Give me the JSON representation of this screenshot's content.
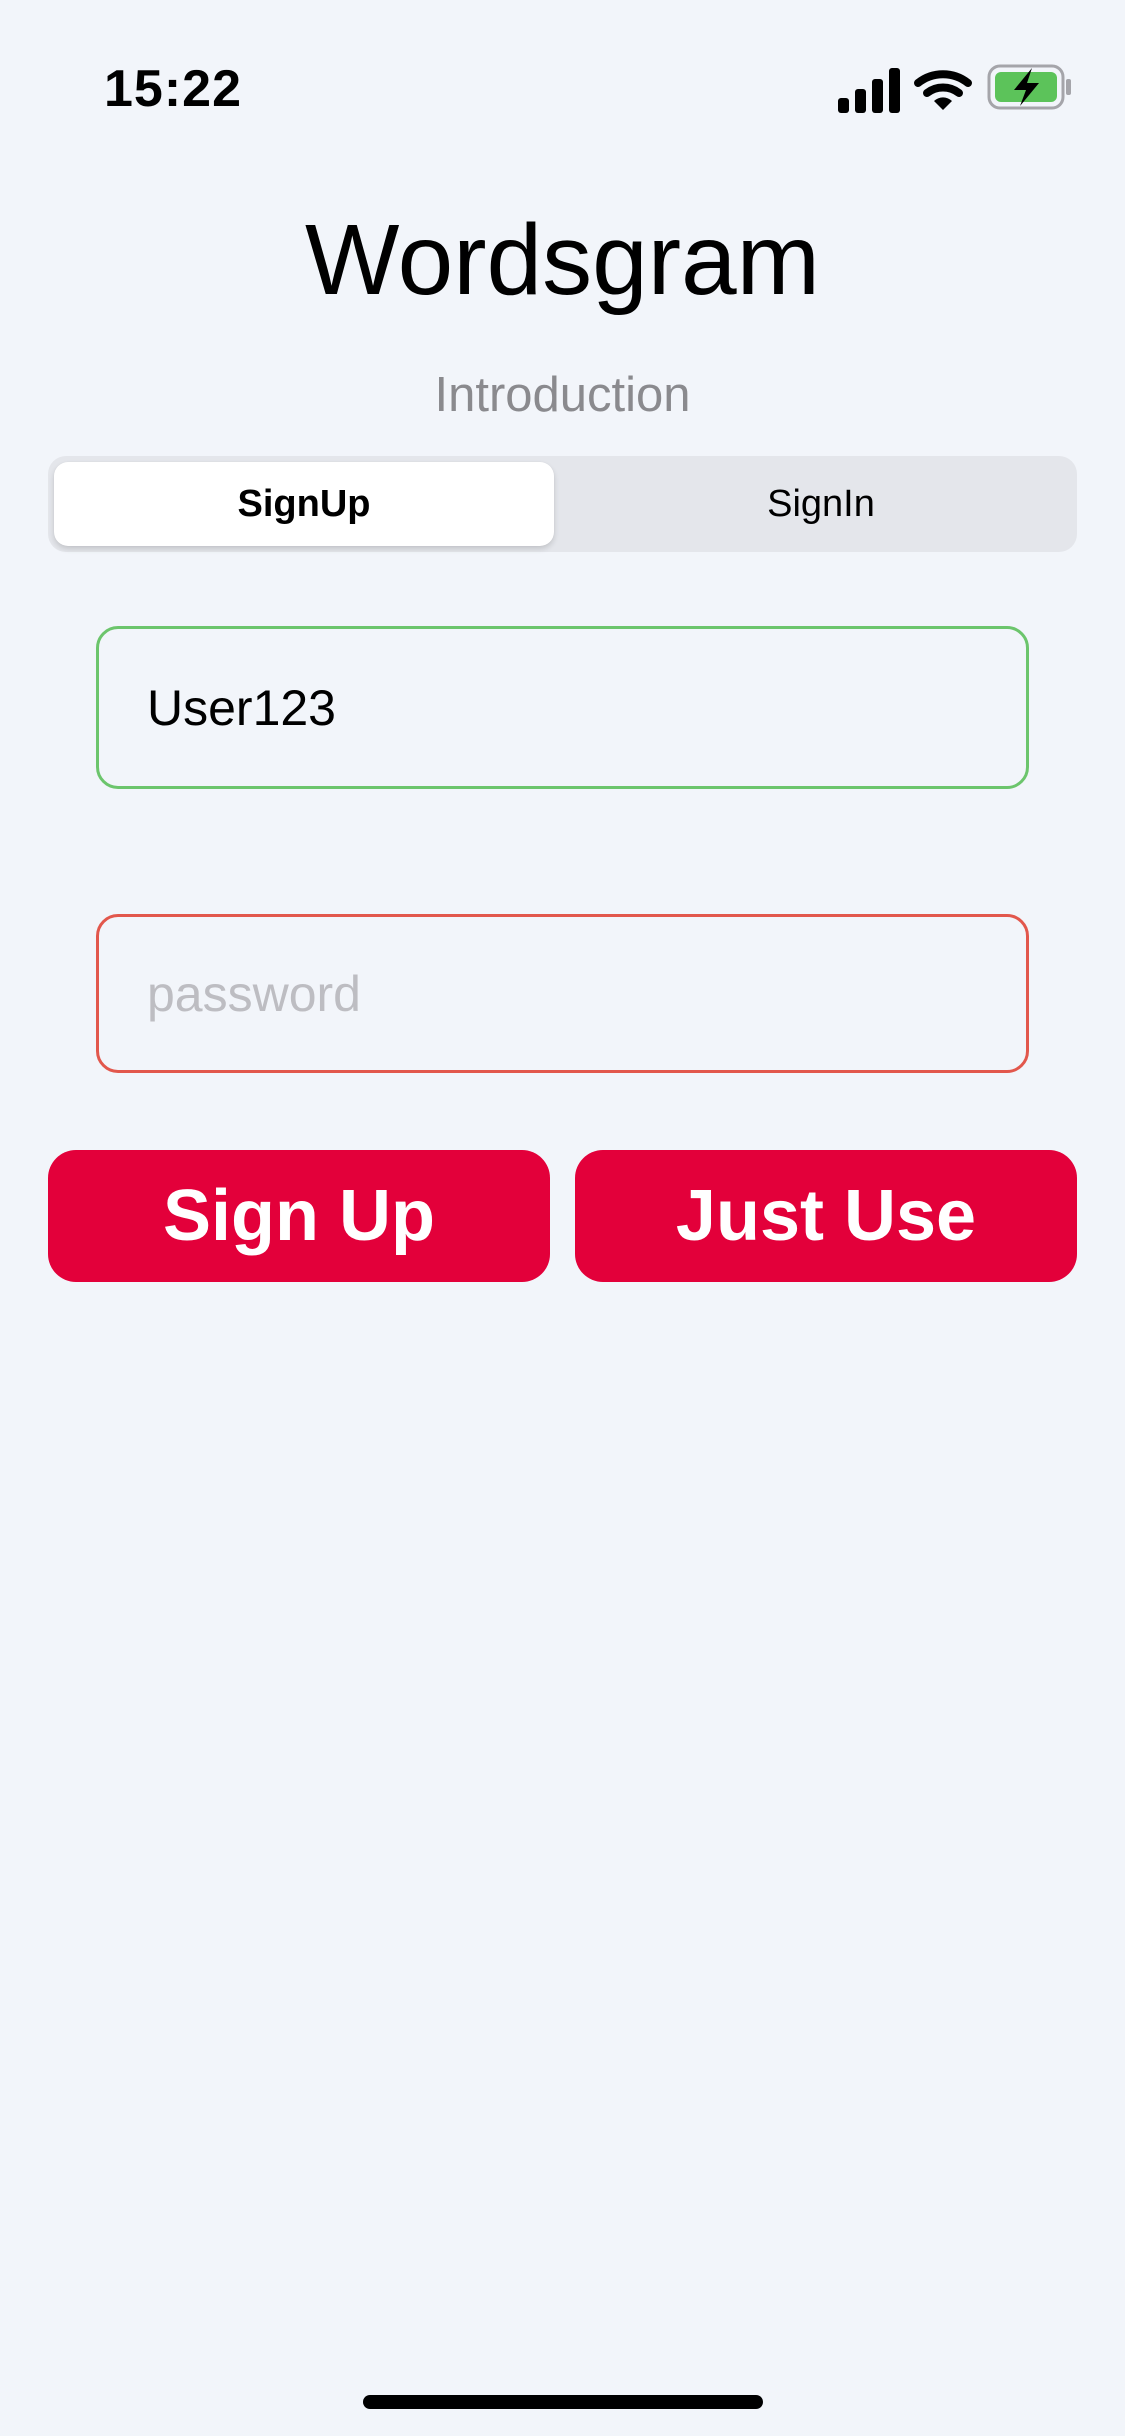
{
  "status_bar": {
    "time": "15:22",
    "icons": [
      "cellular-signal-icon",
      "wifi-icon",
      "battery-charging-icon"
    ],
    "battery_color": "#5cc35a"
  },
  "header": {
    "title": "Wordsgram",
    "subtitle": "Introduction"
  },
  "segmented_control": {
    "options": [
      {
        "label": "SignUp",
        "selected": true
      },
      {
        "label": "SignIn",
        "selected": false
      }
    ]
  },
  "form": {
    "username": {
      "value": "User123",
      "border_color": "#6cc56c"
    },
    "password": {
      "value": "",
      "placeholder": "password",
      "border_color": "#e2574c"
    }
  },
  "actions": {
    "sign_up_label": "Sign Up",
    "just_use_label": "Just Use",
    "button_color": "#e3003a"
  }
}
